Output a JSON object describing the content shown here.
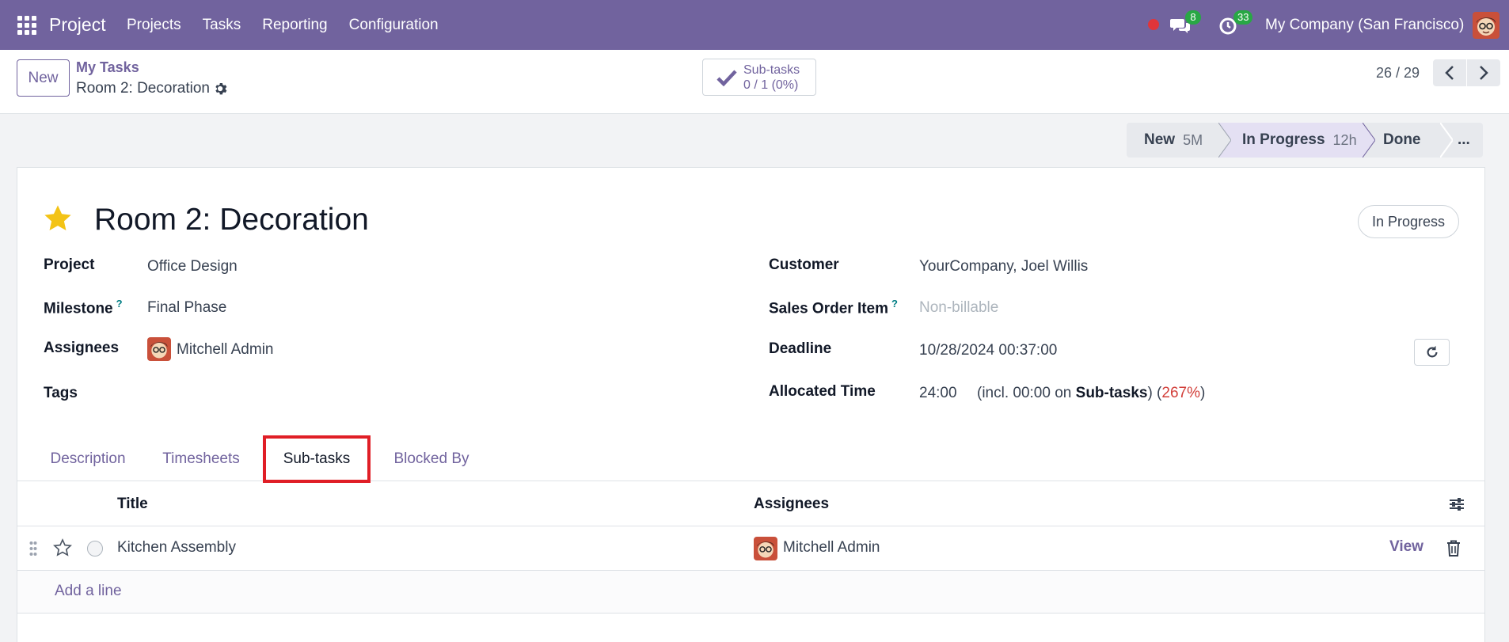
{
  "navbar": {
    "app_name": "Project",
    "menu": [
      "Projects",
      "Tasks",
      "Reporting",
      "Configuration"
    ],
    "messages_count": "8",
    "activities_count": "33",
    "company": "My Company (San Francisco)",
    "bg_color": "#71639e"
  },
  "control_panel": {
    "new_label": "New",
    "breadcrumb_parent": "My Tasks",
    "breadcrumb_current": "Room 2: Decoration",
    "smart_button": {
      "label": "Sub-tasks",
      "value": "0 / 1 (0%)"
    },
    "pager": "26 / 29"
  },
  "stages": [
    {
      "label": "New",
      "duration": "5M",
      "active": false
    },
    {
      "label": "In Progress",
      "duration": "12h",
      "active": true
    },
    {
      "label": "Done",
      "duration": "",
      "active": false
    },
    {
      "label": "...",
      "duration": "",
      "active": false
    }
  ],
  "form": {
    "title": "Room 2: Decoration",
    "favorite": true,
    "status": "In Progress",
    "left_fields": {
      "project_label": "Project",
      "project_value": "Office Design",
      "milestone_label": "Milestone",
      "milestone_help": "?",
      "milestone_value": "Final Phase",
      "assignees_label": "Assignees",
      "assignees_value": "Mitchell Admin",
      "tags_label": "Tags"
    },
    "right_fields": {
      "customer_label": "Customer",
      "customer_value": "YourCompany, Joel Willis",
      "so_item_label": "Sales Order Item",
      "so_item_help": "?",
      "so_item_placeholder": "Non-billable",
      "deadline_label": "Deadline",
      "deadline_value": "10/28/2024 00:37:00",
      "allocated_label": "Allocated Time",
      "allocated_value": "24:00",
      "allocated_incl_prefix": "(incl. 00:00 on ",
      "allocated_incl_bold": "Sub-tasks",
      "allocated_incl_suffix": ") (",
      "allocated_percent": "267%",
      "allocated_close": ")"
    }
  },
  "tabs": [
    {
      "label": "Description",
      "active": false
    },
    {
      "label": "Timesheets",
      "active": false
    },
    {
      "label": "Sub-tasks",
      "active": true
    },
    {
      "label": "Blocked By",
      "active": false
    }
  ],
  "subtasks": {
    "columns": {
      "title": "Title",
      "assignees": "Assignees"
    },
    "rows": [
      {
        "title": "Kitchen Assembly",
        "assignee": "Mitchell Admin",
        "view_label": "View"
      }
    ],
    "add_line": "Add a line"
  }
}
